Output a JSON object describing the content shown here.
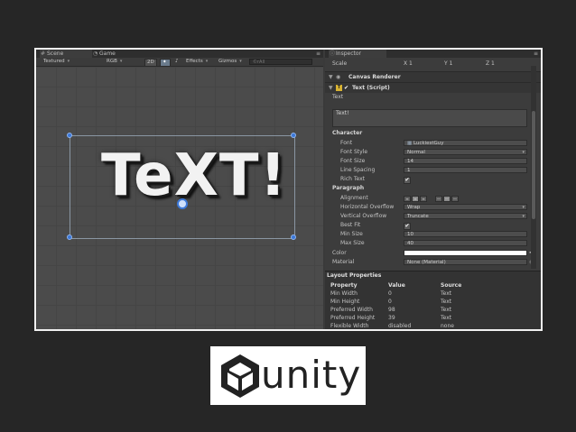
{
  "scene": {
    "tabs": [
      {
        "label": "Scene",
        "icon": "grid-icon"
      },
      {
        "label": "Game",
        "icon": "pacman-icon"
      }
    ],
    "toolbar": {
      "render_mode": "Textured",
      "color_mode": "RGB",
      "mode_2d": "2D",
      "effects": "Effects",
      "gizmos": "Gizmos",
      "search_placeholder": "©rAll"
    },
    "canvas_text": "TeXT!"
  },
  "inspector": {
    "title": "Inspector",
    "scale": {
      "label": "Scale",
      "x": "X 1",
      "y": "Y 1",
      "z": "Z 1"
    },
    "canvas_renderer": "Canvas Renderer",
    "component": "Text (Script)",
    "text_label": "Text",
    "text_value": "Text!",
    "character_header": "Character",
    "font_label": "Font",
    "font_value": "LuckiestGuy",
    "font_style_label": "Font Style",
    "font_style_value": "Normal",
    "font_size_label": "Font Size",
    "font_size_value": "14",
    "line_spacing_label": "Line Spacing",
    "line_spacing_value": "1",
    "rich_text_label": "Rich Text",
    "rich_text_checked": true,
    "paragraph_header": "Paragraph",
    "alignment_label": "Alignment",
    "h_overflow_label": "Horizontal Overflow",
    "h_overflow_value": "Wrap",
    "v_overflow_label": "Vertical Overflow",
    "v_overflow_value": "Truncate",
    "best_fit_label": "Best Fit",
    "best_fit_checked": true,
    "min_size_label": "Min Size",
    "min_size_value": "10",
    "max_size_label": "Max Size",
    "max_size_value": "40",
    "color_label": "Color",
    "color_value": "#ffffff",
    "material_label": "Material",
    "material_value": "None (Material)",
    "checkmark": "✔"
  },
  "layout_properties": {
    "title": "Layout Properties",
    "columns": [
      "Property",
      "Value",
      "Source"
    ],
    "rows": [
      [
        "Min Width",
        "0",
        "Text"
      ],
      [
        "Min Height",
        "0",
        "Text"
      ],
      [
        "Preferred Width",
        "98",
        "Text"
      ],
      [
        "Preferred Height",
        "39",
        "Text"
      ],
      [
        "Flexible Width",
        "disabled",
        "none"
      ]
    ]
  },
  "logo": {
    "word": "unity",
    "colors": {
      "mark": "#222222",
      "background": "#ffffff"
    }
  }
}
